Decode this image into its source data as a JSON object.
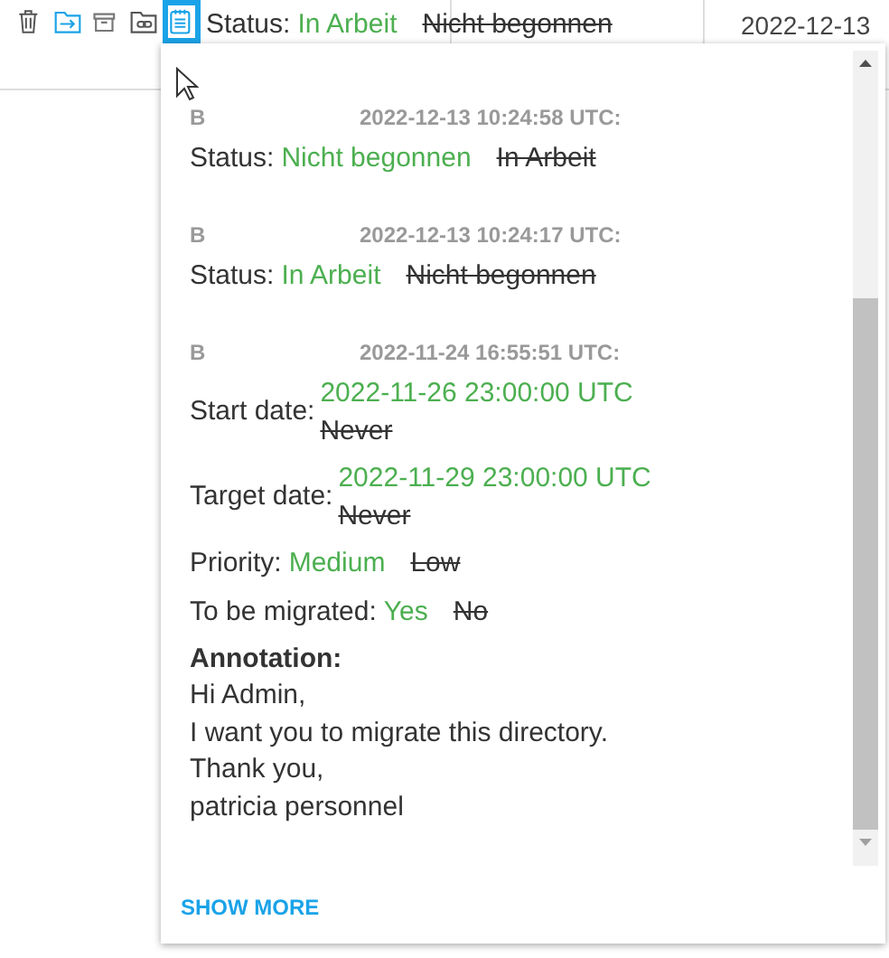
{
  "row": {
    "icons": [
      {
        "kind": "trash",
        "selected": false
      },
      {
        "kind": "move",
        "selected": false
      },
      {
        "kind": "archive",
        "selected": false
      },
      {
        "kind": "folder-link",
        "selected": false
      },
      {
        "kind": "notes",
        "selected": true
      }
    ],
    "status_label": "Status:",
    "status_new": "In Arbeit",
    "status_old": "Nicht begonnen",
    "date": "2022-12-13"
  },
  "history": {
    "entries": [
      {
        "user": "B",
        "time": "2022-12-13 10:24:58 UTC:",
        "changes": [
          {
            "kind": "inline",
            "field": "Status:",
            "new": "Nicht begonnen",
            "old": "In Arbeit"
          }
        ]
      },
      {
        "user": "B",
        "time": "2022-12-13 10:24:17 UTC:",
        "changes": [
          {
            "kind": "inline",
            "field": "Status:",
            "new": "In Arbeit",
            "old": "Nicht begonnen"
          }
        ]
      },
      {
        "user": "B",
        "time": "2022-11-24 16:55:51 UTC:",
        "changes": [
          {
            "kind": "stacked",
            "field": "Start date:",
            "new": "2022-11-26 23:00:00 UTC",
            "old": "Never"
          },
          {
            "kind": "stacked",
            "field": "Target date:",
            "new": "2022-11-29 23:00:00 UTC",
            "old": "Never"
          },
          {
            "kind": "inline",
            "field": "Priority:",
            "new": "Medium",
            "old": "Low"
          },
          {
            "kind": "inline",
            "field": "To be migrated:",
            "new": "Yes",
            "old": "No"
          }
        ],
        "annotation": {
          "label": "Annotation:",
          "lines": [
            "Hi Admin,",
            "I want you to migrate this directory.",
            "Thank you,",
            "patricia personnel"
          ]
        }
      }
    ],
    "show_more": "SHOW MORE"
  }
}
